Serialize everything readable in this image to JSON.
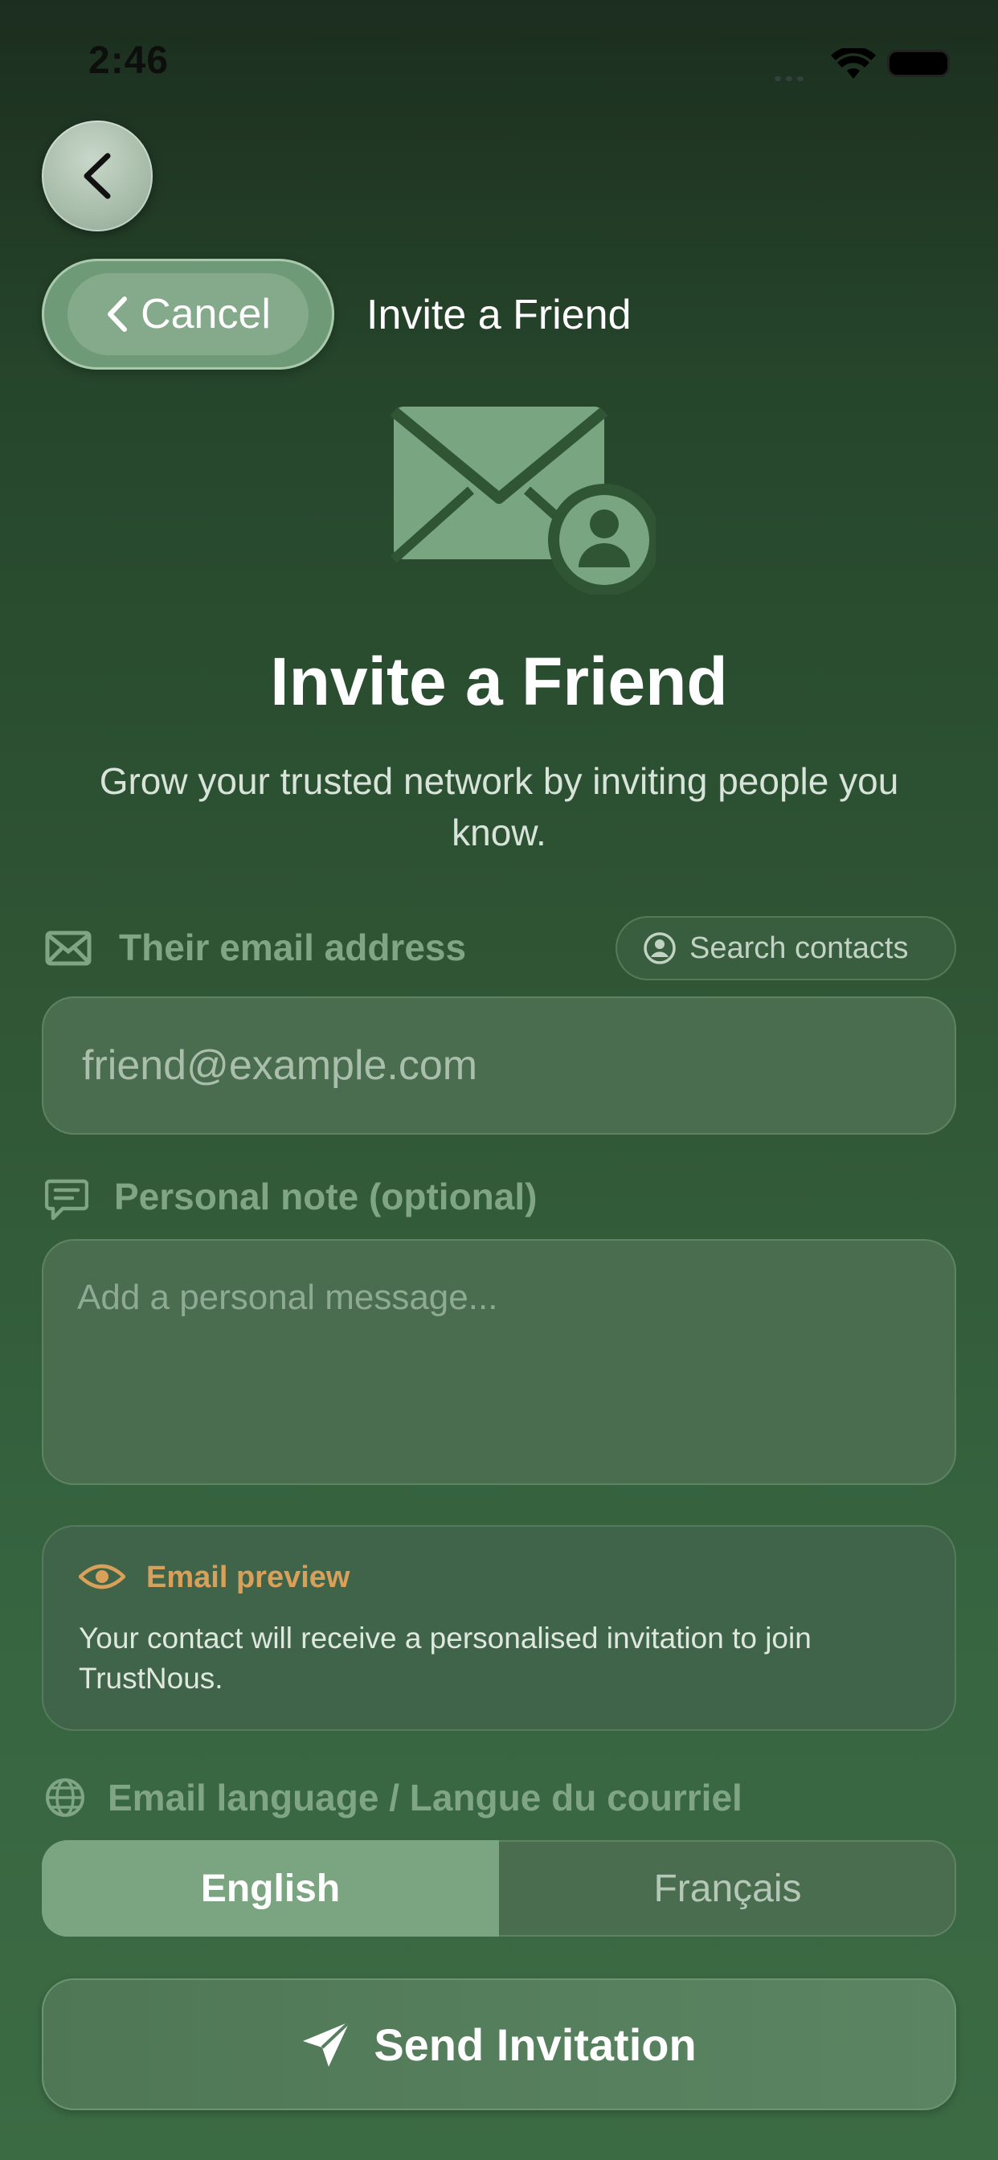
{
  "status_bar": {
    "time": "2:46"
  },
  "header": {
    "cancel_label": "Cancel",
    "title": "Invite a Friend"
  },
  "hero": {
    "title": "Invite a Friend",
    "subtitle": "Grow your trusted network by inviting people you know."
  },
  "form": {
    "email_label": "Their email address",
    "search_contacts_label": "Search contacts",
    "email_placeholder": "friend@example.com",
    "note_label": "Personal note (optional)",
    "note_placeholder": "Add a personal message..."
  },
  "preview": {
    "title": "Email preview",
    "body": "Your contact will receive a personalised invitation to join TrustNous."
  },
  "language": {
    "label": "Email language / Langue du courriel",
    "options": [
      "English",
      "Français"
    ],
    "selected": "English"
  },
  "actions": {
    "send_label": "Send Invitation"
  },
  "colors": {
    "accent": "#7ba480",
    "preview_title": "#d9a05a",
    "label": "#7fa585"
  }
}
